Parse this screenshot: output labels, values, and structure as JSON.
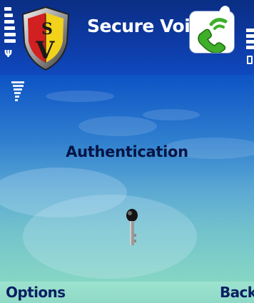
{
  "status_bar": {
    "app_title": "Secure Voi",
    "signal_icon": "signal-strength-icon",
    "battery_icon": "battery-level-icon",
    "app_icon": "secure-voice-shield-logo",
    "call_icon": "phone-handset-icon"
  },
  "main": {
    "label": "Authentication",
    "key_icon": "key-icon"
  },
  "softkeys": {
    "left": "Options",
    "right": "Back"
  },
  "colors": {
    "title_text": "#ffffff",
    "label_text": "#051545",
    "softkey_text": "#0b1f63",
    "phone_green": "#3fae2a"
  }
}
